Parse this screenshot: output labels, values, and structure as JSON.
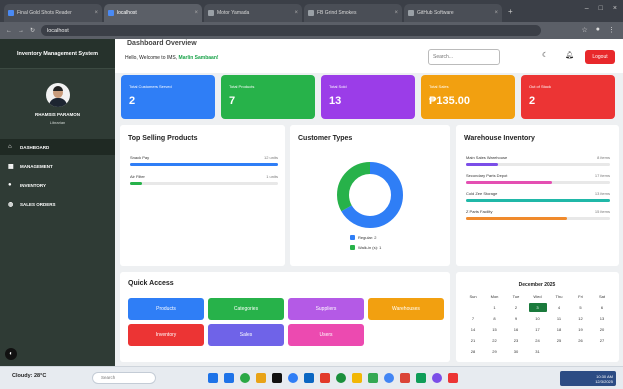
{
  "browser": {
    "tabs": [
      {
        "label": "Final Gold Shots Reader",
        "color": "#4a8af4"
      },
      {
        "label": "localhost",
        "color": "#4a8af4"
      },
      {
        "label": "Motor Yamada",
        "color": "#9aa0a6"
      },
      {
        "label": "FB Grind Smokes",
        "color": "#9aa0a6"
      },
      {
        "label": "GitHub Software",
        "color": "#9aa0a6"
      }
    ],
    "url": "localhost"
  },
  "sidebar": {
    "title": "Inventory Management System",
    "user_name": "RHAMSIS PARAMON",
    "user_role": "Librarian",
    "items": [
      {
        "label": "DASHBOARD",
        "icon": "home-icon",
        "glyph": "⌂"
      },
      {
        "label": "MANAGEMENT",
        "icon": "grid-icon",
        "glyph": "▦"
      },
      {
        "label": "INVENTORY",
        "icon": "box-icon",
        "glyph": "●"
      },
      {
        "label": "SALES ORDERS",
        "icon": "search-icon",
        "glyph": "◍"
      }
    ]
  },
  "header": {
    "title": "Dashboard Overview",
    "welcome_prefix": "Hello, Welcome to IMS, ",
    "welcome_name": "Marlin Sambaan!",
    "search_placeholder": "Search...",
    "logout_label": "Logout"
  },
  "stats": [
    {
      "label": "Total Customers Served",
      "value": "2",
      "color": "#2f7ef6"
    },
    {
      "label": "Total Products",
      "value": "7",
      "color": "#27b24a"
    },
    {
      "label": "Total Sold",
      "value": "13",
      "color": "#9b3de8"
    },
    {
      "label": "Total Sales",
      "value": "₱135.00",
      "color": "#f2a010"
    },
    {
      "label": "Out of Stock",
      "value": "2",
      "color": "#ec3434"
    }
  ],
  "top_selling": {
    "title": "Top Selling Products",
    "items": [
      {
        "name": "Snack Pay",
        "value": "12 units",
        "fraction": 1.0,
        "color": "#2f7ef6"
      },
      {
        "name": "Air Filter",
        "value": "1 units",
        "fraction": 0.08,
        "color": "#27b24a"
      }
    ]
  },
  "customer_types": {
    "title": "Customer Types",
    "legend": [
      {
        "label": "Regular: 2",
        "color": "#2f7ef6"
      },
      {
        "label": "Walk-in (s): 1",
        "color": "#27b24a"
      }
    ],
    "slices": [
      {
        "value": 2,
        "color": "#2f7ef6"
      },
      {
        "value": 1,
        "color": "#27b24a"
      }
    ]
  },
  "warehouse": {
    "title": "Warehouse Inventory",
    "items": [
      {
        "name": "Main Sales Warehouse",
        "value": "8 items",
        "fraction": 0.22,
        "color": "#7b4ee8"
      },
      {
        "name": "Secondary Parts Depot",
        "value": "17 items",
        "fraction": 0.6,
        "color": "#e44fb2"
      },
      {
        "name": "Cold Zee Storage",
        "value": "13 items",
        "fraction": 1.0,
        "color": "#20b8a8"
      },
      {
        "name": "Z Parts Facility",
        "value": "15 items",
        "fraction": 0.7,
        "color": "#f08a2c"
      }
    ]
  },
  "quick_access": {
    "title": "Quick Access",
    "buttons": [
      {
        "label": "Products",
        "color": "#2f7ef6"
      },
      {
        "label": "Categories",
        "color": "#27b24a"
      },
      {
        "label": "Suppliers",
        "color": "#b45ae6"
      },
      {
        "label": "Warehouses",
        "color": "#f2a010"
      },
      {
        "label": "Inventory",
        "color": "#ec3434"
      },
      {
        "label": "Sales",
        "color": "#6f63e8"
      },
      {
        "label": "Users",
        "color": "#ec4ab0"
      }
    ]
  },
  "calendar": {
    "title": "December 2025",
    "weekdays": [
      "Sun",
      "Mon",
      "Tue",
      "Wed",
      "Thu",
      "Fri",
      "Sat"
    ],
    "first_weekday": 1,
    "days_in_month": 31,
    "today": 3
  },
  "taskbar": {
    "weather": "Cloudy: 28°C",
    "search_placeholder": "Search",
    "time": "10:30 AM",
    "date": "12/3/2025",
    "icon_colors": [
      "#1e73e8",
      "#2aa845",
      "#e8a317",
      "#111111",
      "#2f7ef6",
      "#0a66c2",
      "#e23a2a",
      "#1a8f3c",
      "#f2b705",
      "#34a853",
      "#4285f4",
      "#db4437",
      "#0f9d58",
      "#7b4ee8",
      "#ec3434"
    ]
  }
}
